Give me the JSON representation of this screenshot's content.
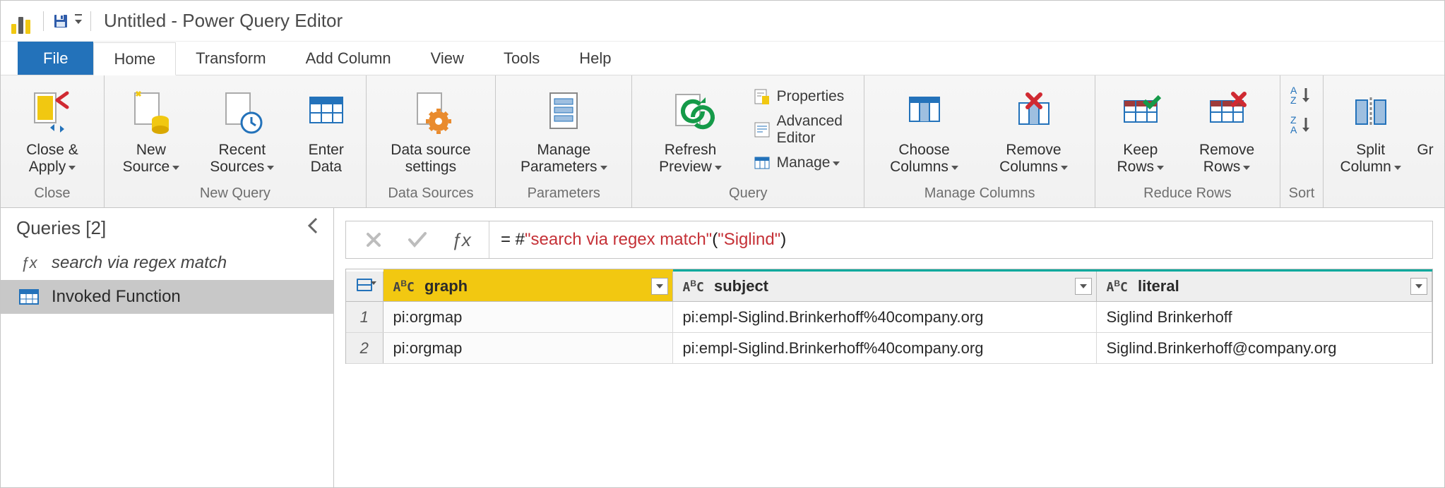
{
  "window": {
    "title": "Untitled - Power Query Editor"
  },
  "ribbon_tabs": {
    "file": "File",
    "home": "Home",
    "transform": "Transform",
    "add_column": "Add Column",
    "view": "View",
    "tools": "Tools",
    "help": "Help"
  },
  "ribbon": {
    "groups": {
      "close": {
        "label": "Close",
        "close_apply": "Close & Apply"
      },
      "new_query": {
        "label": "New Query",
        "new_source": "New Source",
        "recent_sources": "Recent Sources",
        "enter_data": "Enter Data"
      },
      "data_sources": {
        "label": "Data Sources",
        "data_source_settings": "Data source settings"
      },
      "parameters": {
        "label": "Parameters",
        "manage_parameters": "Manage Parameters"
      },
      "query": {
        "label": "Query",
        "refresh_preview": "Refresh Preview",
        "properties": "Properties",
        "advanced_editor": "Advanced Editor",
        "manage": "Manage"
      },
      "manage_columns": {
        "label": "Manage Columns",
        "choose_columns": "Choose Columns",
        "remove_columns": "Remove Columns"
      },
      "reduce_rows": {
        "label": "Reduce Rows",
        "keep_rows": "Keep Rows",
        "remove_rows": "Remove Rows"
      },
      "sort": {
        "label": "Sort"
      },
      "transform": {
        "split_column": "Split Column",
        "group_by": "Gr"
      }
    }
  },
  "queries_pane": {
    "title": "Queries [2]",
    "items": [
      {
        "icon": "fx",
        "label": "search via regex match"
      },
      {
        "icon": "table",
        "label": "Invoked Function"
      }
    ]
  },
  "formula_bar": {
    "prefix": "= #",
    "func": "\"search via regex match\"",
    "open": "(",
    "arg": "\"Siglind\"",
    "close": ")"
  },
  "grid": {
    "columns": [
      {
        "name": "graph"
      },
      {
        "name": "subject"
      },
      {
        "name": "literal"
      }
    ],
    "rows": [
      {
        "n": "1",
        "graph": "pi:orgmap",
        "subject": "pi:empl-Siglind.Brinkerhoff%40company.org",
        "literal": "Siglind Brinkerhoff"
      },
      {
        "n": "2",
        "graph": "pi:orgmap",
        "subject": "pi:empl-Siglind.Brinkerhoff%40company.org",
        "literal": "Siglind.Brinkerhoff@company.org"
      }
    ]
  }
}
